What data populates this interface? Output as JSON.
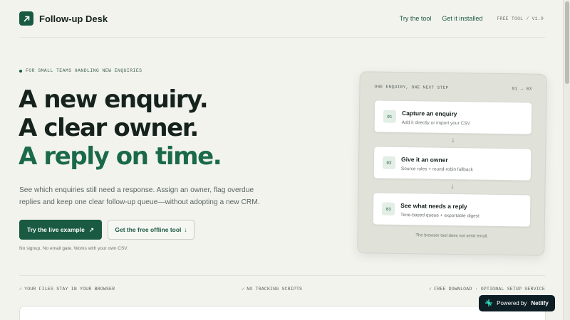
{
  "header": {
    "app_name": "Follow-up Desk",
    "nav": [
      {
        "label": "Try the tool"
      },
      {
        "label": "Get it installed"
      }
    ],
    "version": "FREE TOOL / V1.0"
  },
  "hero": {
    "kicker": "FOR SMALL TEAMS HANDLING NEW ENQUIRIES",
    "headline": [
      "A new enquiry.",
      "A clear owner.",
      "A reply on time."
    ],
    "lede": "See which enquiries still need a response. Assign an owner, flag overdue replies and keep one clear follow-up queue—without adopting a new CRM.",
    "primary_cta": "Try the live example",
    "primary_cta_icon": "↗",
    "secondary_cta": "Get the free offline tool",
    "secondary_cta_icon": "↓",
    "note": "No signup. No email gate. Works with your own CSV."
  },
  "preview": {
    "label": "ONE ENQUIRY, ONE NEXT STEP",
    "counter": "01 → 03",
    "steps": [
      {
        "num": "01",
        "title": "Capture an enquiry",
        "sub": "Add it directly or import your CSV"
      },
      {
        "num": "02",
        "title": "Give it an owner",
        "sub": "Source rules + round-robin fallback"
      },
      {
        "num": "03",
        "title": "See what needs a reply",
        "sub": "Time-based queue + exportable digest"
      }
    ],
    "arrow": "↓",
    "footnote": "The browser tool does not send email."
  },
  "trust": {
    "check": "✓",
    "items": [
      "YOUR FILES STAY IN YOUR BROWSER",
      "NO TRACKING SCRIPTS",
      "FREE DOWNLOAD · OPTIONAL SETUP SERVICE"
    ]
  },
  "badge": {
    "prefix": "Powered by",
    "brand": "Netlify",
    "icon": "netlify-mark"
  },
  "colors": {
    "brand": "#1a5a43",
    "accent_text": "#1a6a49",
    "background": "#f3f3ee"
  }
}
